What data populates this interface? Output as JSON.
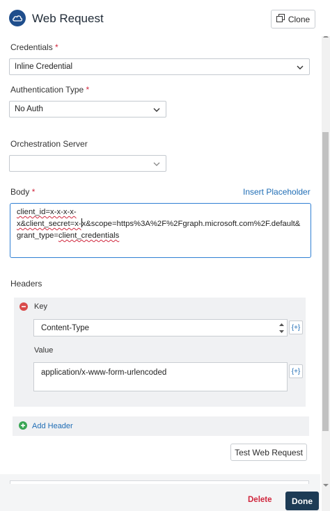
{
  "header": {
    "title": "Web Request",
    "clone_label": "Clone"
  },
  "credentials": {
    "label": "Credentials",
    "required": "*",
    "value": "Inline Credential"
  },
  "auth": {
    "label": "Authentication Type",
    "required": "*",
    "value": "No Auth"
  },
  "orchestration": {
    "label": "Orchestration Server",
    "value": ""
  },
  "body": {
    "label": "Body",
    "required": "*",
    "insert_placeholder": "Insert Placeholder",
    "line1": "client_id=x-x-x-x-",
    "line2_a": "x&client_secret=x-",
    "line2_b": "x&scope=https%3A%2F%2Fgraph.microsoft.com%2F.default&",
    "line3_a": "grant_type=",
    "line3_b": "client_credentials"
  },
  "headers": {
    "label": "Headers",
    "key_label": "Key",
    "key_value": "Content-Type",
    "value_label": "Value",
    "value_value": "application/x-www-form-urlencoded",
    "param_button": "{+}",
    "add_header": "Add Header"
  },
  "actions": {
    "test": "Test Web Request",
    "delete": "Delete",
    "done": "Done"
  },
  "colors": {
    "accent": "#1f6db5",
    "required": "#d0263d",
    "done_bg": "#1d3b55",
    "remove": "#d94a4a",
    "add": "#3aa655"
  }
}
